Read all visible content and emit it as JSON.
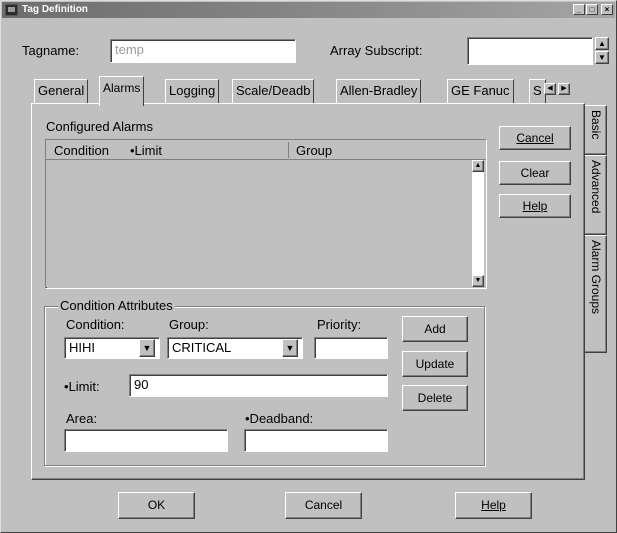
{
  "window": {
    "title": "Tag Definition"
  },
  "header": {
    "tagname_label": "Tagname:",
    "tagname_value": "temp",
    "array_label": "Array Subscript:",
    "array_value": ""
  },
  "tabs": [
    {
      "label": "General"
    },
    {
      "label": "Alarms"
    },
    {
      "label": "Logging"
    },
    {
      "label": "Scale/Deadb"
    },
    {
      "label": "Allen-Bradley"
    },
    {
      "label": "GE Fanuc"
    },
    {
      "label": "S"
    }
  ],
  "side_tabs": [
    {
      "label": "Basic"
    },
    {
      "label": "Advanced"
    },
    {
      "label": "Alarm Groups"
    }
  ],
  "configured_alarms": {
    "title": "Configured Alarms",
    "columns": [
      "Condition",
      "•Limit",
      "Group"
    ],
    "rows": []
  },
  "side_buttons": {
    "cancel": "Cancel",
    "clear": "Clear",
    "help": "Help"
  },
  "condition_attributes": {
    "title": "Condition Attributes",
    "condition_label": "Condition:",
    "condition_value": "HIHI",
    "group_label": "Group:",
    "group_value": "CRITICAL",
    "priority_label": "Priority:",
    "priority_value": "",
    "limit_label": "•Limit:",
    "limit_value": "90",
    "area_label": "Area:",
    "area_value": "",
    "deadband_label": "•Deadband:",
    "deadband_value": "",
    "add_label": "Add",
    "update_label": "Update",
    "delete_label": "Delete"
  },
  "footer": {
    "ok": "OK",
    "cancel": "Cancel",
    "help": "Help"
  }
}
